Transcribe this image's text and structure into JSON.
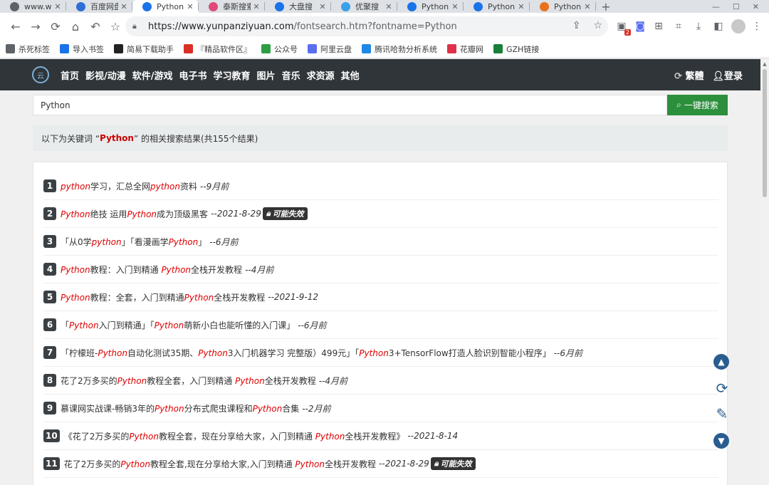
{
  "browser": {
    "tabs": [
      {
        "title": "www.w",
        "icon": "globe-icon",
        "color": "#5f6368"
      },
      {
        "title": "百度网盘",
        "icon": "baidu-pan-icon",
        "color": "#2f6fd6"
      },
      {
        "title": "Python",
        "icon": "search-icon",
        "color": "#1a73e8"
      },
      {
        "title": "泰斯搜索",
        "icon": "colorful-icon",
        "color": "#e04a7a"
      },
      {
        "title": "大盘搜",
        "icon": "cloud-icon",
        "color": "#1a73e8"
      },
      {
        "title": "优聚搜",
        "icon": "cloud-icon",
        "color": "#3aa0e8"
      },
      {
        "title": "Python",
        "icon": "app-icon",
        "color": "#1a73e8"
      },
      {
        "title": "Python",
        "icon": "search-icon",
        "color": "#1a73e8"
      },
      {
        "title": "Python",
        "icon": "ji-icon",
        "color": "#e8711a"
      }
    ],
    "active_tab": 2,
    "url_host": "https://www.yunpanziyuan.com",
    "url_path": "/fontsearch.htm?fontname=Python",
    "ext_badge": "2",
    "bookmarks": [
      {
        "label": "杀死标签",
        "icon": "globe-icon",
        "color": "#5f6368"
      },
      {
        "label": "导入书签",
        "icon": "gear-icon",
        "color": "#1a73e8"
      },
      {
        "label": "简易下载助手",
        "icon": "download-icon",
        "color": "#222"
      },
      {
        "label": "『精品软件区』",
        "icon": "software-icon",
        "color": "#d93025"
      },
      {
        "label": "公众号",
        "icon": "wechat-icon",
        "color": "#2e9e44"
      },
      {
        "label": "阿里云盘",
        "icon": "aliyun-icon",
        "color": "#5a6ef0"
      },
      {
        "label": "腾讯哈勃分析系统",
        "icon": "tencent-icon",
        "color": "#1e88e5"
      },
      {
        "label": "花瓣网",
        "icon": "huaban-icon",
        "color": "#e0304a"
      },
      {
        "label": "GZH链接",
        "icon": "sheet-icon",
        "color": "#188038"
      }
    ]
  },
  "site": {
    "nav": [
      "首页",
      "影视/动漫",
      "软件/游戏",
      "电子书",
      "学习教育",
      "图片",
      "音乐",
      "求资源",
      "其他"
    ],
    "traditional": "繁體",
    "login": "登录",
    "search_value": "Python",
    "search_button": "一键搜索",
    "summary_prefix": "以下为关键词 “",
    "summary_keyword": "Python",
    "summary_suffix": "” 的相关搜索结果(共155个结果)"
  },
  "results": [
    {
      "num": "1",
      "parts": [
        [
          "python",
          true
        ],
        [
          "学习，汇总全网",
          false
        ],
        [
          "python",
          true
        ],
        [
          "资料",
          false
        ]
      ],
      "date": "--9月前",
      "invalid": ""
    },
    {
      "num": "2",
      "parts": [
        [
          "Python",
          true
        ],
        [
          "绝技 运用",
          false
        ],
        [
          "Python",
          true
        ],
        [
          "成为顶级黑客",
          false
        ]
      ],
      "date": "--2021-8-29",
      "invalid": "可能失效"
    },
    {
      "num": "3",
      "parts": [
        [
          "「从0学",
          false
        ],
        [
          "python",
          true
        ],
        [
          "」「看漫画学",
          false
        ],
        [
          "Python",
          true
        ],
        [
          "」",
          false
        ]
      ],
      "date": "--6月前",
      "invalid": ""
    },
    {
      "num": "4",
      "parts": [
        [
          "Python",
          true
        ],
        [
          "教程：入门到精通 ",
          false
        ],
        [
          "Python",
          true
        ],
        [
          "全栈开发教程",
          false
        ]
      ],
      "date": "--4月前",
      "invalid": ""
    },
    {
      "num": "5",
      "parts": [
        [
          "Python",
          true
        ],
        [
          "教程：全套，入门到精通",
          false
        ],
        [
          "Python",
          true
        ],
        [
          "全栈开发教程",
          false
        ]
      ],
      "date": "--2021-9-12",
      "invalid": ""
    },
    {
      "num": "6",
      "parts": [
        [
          "「",
          false
        ],
        [
          "Python",
          true
        ],
        [
          "入门到精通」「",
          false
        ],
        [
          "Python",
          true
        ],
        [
          "萌新小白也能听懂的入门课」",
          false
        ]
      ],
      "date": "--6月前",
      "invalid": ""
    },
    {
      "num": "7",
      "parts": [
        [
          "「柠檬班-",
          false
        ],
        [
          "Python",
          true
        ],
        [
          "自动化测试35期、",
          false
        ],
        [
          "Python",
          true
        ],
        [
          "3入门机器学习 完整版）499元」「",
          false
        ],
        [
          "Python",
          true
        ],
        [
          "3+TensorFlow打造人脸识别智能小程序」",
          false
        ]
      ],
      "date": "--6月前",
      "invalid": ""
    },
    {
      "num": "8",
      "parts": [
        [
          "花了2万多买的",
          false
        ],
        [
          "Python",
          true
        ],
        [
          "教程全套，入门到精通 ",
          false
        ],
        [
          "Python",
          true
        ],
        [
          "全栈开发教程",
          false
        ]
      ],
      "date": "--4月前",
      "invalid": ""
    },
    {
      "num": "9",
      "parts": [
        [
          "慕课网实战课-畅销3年的",
          false
        ],
        [
          "Python",
          true
        ],
        [
          "分布式爬虫课程和",
          false
        ],
        [
          "Python",
          true
        ],
        [
          "合集",
          false
        ]
      ],
      "date": "--2月前",
      "invalid": ""
    },
    {
      "num": "10",
      "parts": [
        [
          "《花了2万多买的",
          false
        ],
        [
          "Python",
          true
        ],
        [
          "教程全套，现在分享给大家，入门到精通 ",
          false
        ],
        [
          "Python",
          true
        ],
        [
          "全栈开发教程》",
          false
        ]
      ],
      "date": "--2021-8-14",
      "invalid": ""
    },
    {
      "num": "11",
      "parts": [
        [
          "花了2万多买的",
          false
        ],
        [
          "Python",
          true
        ],
        [
          "教程全套,现在分享给大家,入门到精通 ",
          false
        ],
        [
          "Python",
          true
        ],
        [
          "全栈开发教程",
          false
        ]
      ],
      "date": "--2021-8-29",
      "invalid": "可能失效"
    }
  ]
}
